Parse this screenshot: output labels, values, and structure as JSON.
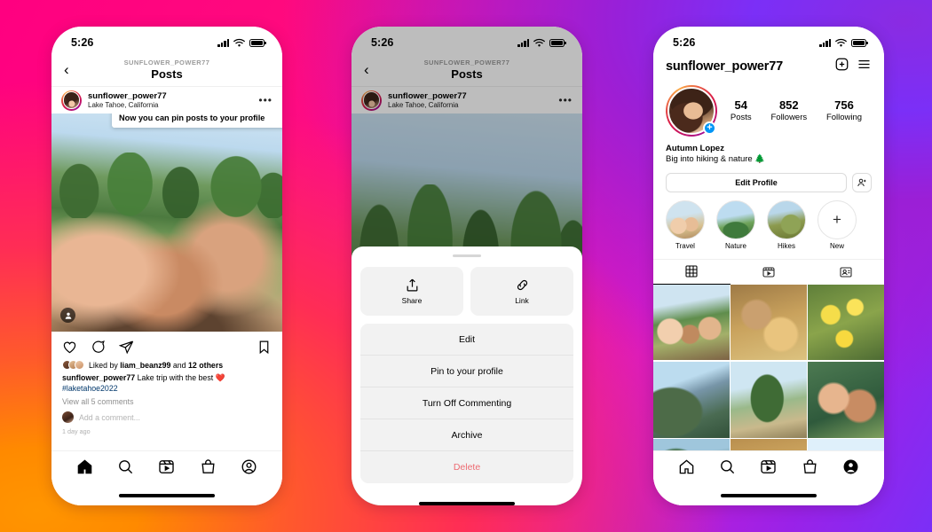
{
  "background": {
    "gradient_colors": [
      "#FF9500",
      "#FF2D55",
      "#FF0080",
      "#D81AC9",
      "#7B2FF7",
      "#8A2BE2"
    ]
  },
  "status_bar": {
    "time": "5:26",
    "signal_icon": "cellular-bars-icon",
    "wifi_icon": "wifi-icon",
    "battery_icon": "battery-full-icon"
  },
  "phone1": {
    "header": {
      "back_icon": "back-chevron-icon",
      "kicker": "SUNFLOWER_POWER77",
      "title": "Posts"
    },
    "post": {
      "author": "sunflower_power77",
      "location": "Lake Tahoe, California",
      "more_icon": "more-options-icon",
      "tooltip": "Now you can pin posts to your profile",
      "tag_icon": "person-tag-icon",
      "actions": {
        "like_icon": "heart-icon",
        "comment_icon": "comment-bubble-icon",
        "share_icon": "send-paper-plane-icon",
        "save_icon": "bookmark-icon"
      },
      "likes_prefix": "Liked by",
      "likes_user": "liam_beanz99",
      "likes_middle": "and",
      "likes_others": "12 others",
      "caption_user": "sunflower_power77",
      "caption_text": "Lake trip with the best ❤️",
      "caption_hashtag": "#laketahoe2022",
      "view_comments": "View all 5 comments",
      "add_comment_placeholder": "Add a comment...",
      "timestamp": "1 day ago"
    },
    "tabbar": [
      "home-icon",
      "search-icon",
      "reels-icon",
      "shop-icon",
      "profile-icon"
    ]
  },
  "phone2": {
    "header": {
      "back_icon": "back-chevron-icon",
      "kicker": "SUNFLOWER_POWER77",
      "title": "Posts"
    },
    "post": {
      "author": "sunflower_power77",
      "location": "Lake Tahoe, California",
      "more_icon": "more-options-icon"
    },
    "sheet": {
      "grabber": "drag-handle",
      "share_label": "Share",
      "share_icon": "share-upload-icon",
      "link_label": "Link",
      "link_icon": "link-chain-icon",
      "items": [
        {
          "label": "Edit",
          "danger": false
        },
        {
          "label": "Pin to your profile",
          "danger": false
        },
        {
          "label": "Turn Off Commenting",
          "danger": false
        },
        {
          "label": "Archive",
          "danger": false
        },
        {
          "label": "Delete",
          "danger": true
        }
      ],
      "delete_color": "#ED6B72"
    }
  },
  "phone3": {
    "username": "sunflower_power77",
    "add_icon": "add-post-icon",
    "menu_icon": "hamburger-menu-icon",
    "avatar_badge_icon": "add-story-plus-icon",
    "stats": [
      {
        "value": "54",
        "label": "Posts"
      },
      {
        "value": "852",
        "label": "Followers"
      },
      {
        "value": "756",
        "label": "Following"
      }
    ],
    "bio_name": "Autumn Lopez",
    "bio_desc": "Big into hiking & nature 🌲",
    "edit_profile_label": "Edit Profile",
    "add_person_icon": "add-person-icon",
    "highlights": [
      {
        "label": "Travel"
      },
      {
        "label": "Nature"
      },
      {
        "label": "Hikes"
      },
      {
        "label": "New"
      }
    ],
    "tabs": [
      "grid-icon",
      "reels-tab-icon",
      "tagged-icon"
    ],
    "grid_photo_count": 9,
    "tabbar": [
      "home-icon",
      "search-icon",
      "reels-icon",
      "shop-icon",
      "profile-icon"
    ],
    "accent_blue": "#0095F6"
  }
}
